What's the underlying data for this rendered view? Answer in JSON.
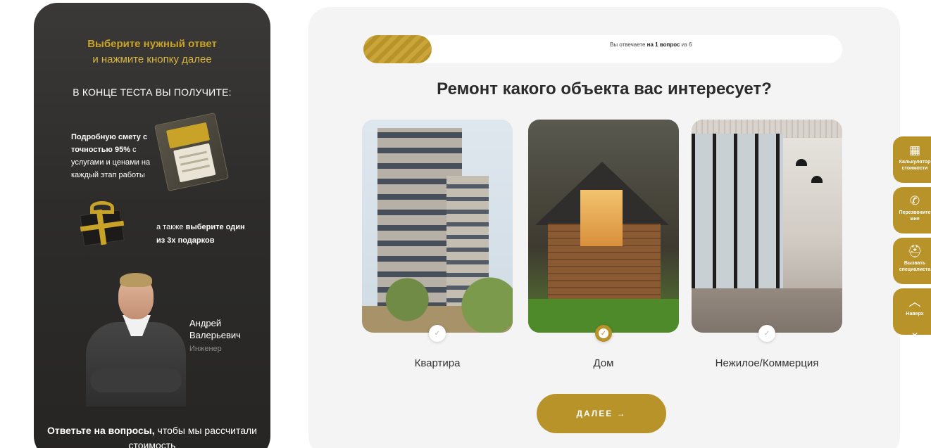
{
  "sidebar_promo": {
    "title": "Выберите нужный ответ",
    "subtitle": "и нажмите кнопку далее",
    "end_heading": "В КОНЦЕ ТЕСТА ВЫ ПОЛУЧИТЕ:",
    "estimate": {
      "bold_text": "Подробную смету с точностью 95%",
      "rest_text": " с услугами и ценами на каждый этап работы"
    },
    "gifts": {
      "prefix": "а также ",
      "bold_text": "выберите один из 3х подарков"
    },
    "expert": {
      "name_line1": "Андрей",
      "name_line2": "Валерьевич",
      "role": "Инженер"
    },
    "bottom_bold": "Ответьте на вопросы,",
    "bottom_rest": " чтобы мы рассчитали стоимость"
  },
  "progress": {
    "prefix": "Вы отвечаете ",
    "bold": "на 1 вопрос",
    "suffix": " из 6",
    "fraction": 0.143
  },
  "question": "Ремонт какого объекта вас интересует?",
  "options": [
    {
      "label": "Квартира",
      "selected": false
    },
    {
      "label": "Дом",
      "selected": true
    },
    {
      "label": "Нежилое/Коммерция",
      "selected": false
    }
  ],
  "next_button": "ДАЛЕЕ →",
  "side_tabs": [
    {
      "label": "Калькулятор стоимости",
      "icon": "calculator-icon"
    },
    {
      "label": "Перезвоните мне",
      "icon": "phone-icon"
    },
    {
      "label": "Вызвать специалиста",
      "icon": "helmet-icon"
    },
    {
      "label": "Наверх",
      "icon": "arrow-up-icon"
    }
  ],
  "accent_color": "#b8932a"
}
